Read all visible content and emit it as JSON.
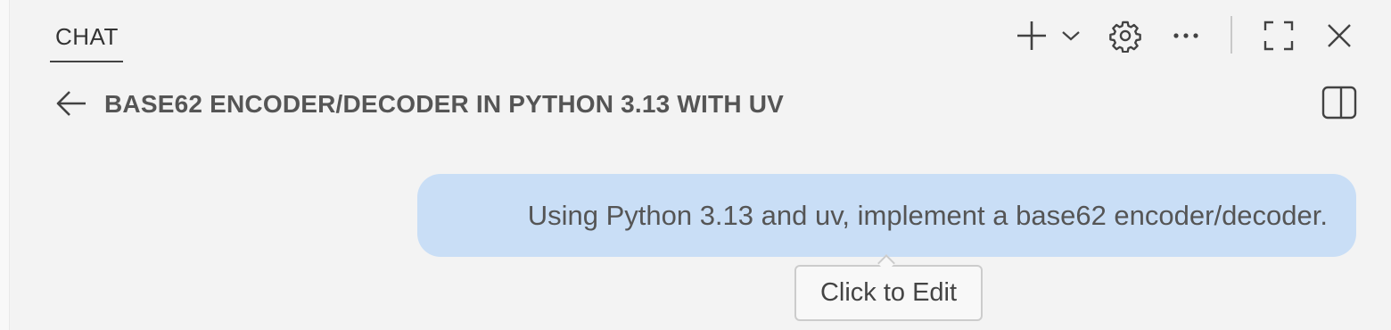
{
  "header": {
    "tab_label": "CHAT",
    "toolbar": {
      "new_chat_icon": "plus-icon",
      "new_chat_dropdown_icon": "chevron-down-icon",
      "settings_icon": "gear-icon",
      "more_icon": "ellipsis-icon",
      "maximize_icon": "maximize-icon",
      "close_icon": "close-icon"
    }
  },
  "session": {
    "back_icon": "arrow-left-icon",
    "title": "BASE62 ENCODER/DECODER IN PYTHON 3.13 WITH UV",
    "split_icon": "split-panel-icon"
  },
  "messages": [
    {
      "role": "user",
      "text": "Using Python 3.13 and uv, implement a base62 encoder/decoder."
    }
  ],
  "tooltip": {
    "text": "Click to Edit"
  },
  "colors": {
    "background": "#f3f3f3",
    "bubble": "#c9def6",
    "text": "#555555"
  }
}
